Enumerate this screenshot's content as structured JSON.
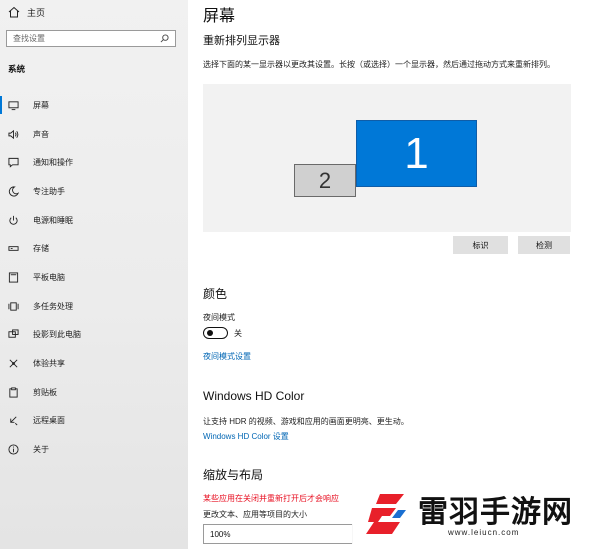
{
  "sidebar": {
    "home_label": "主页",
    "search_placeholder": "查找设置",
    "section_label": "系统",
    "items": [
      {
        "label": "屏幕",
        "icon": "monitor-icon",
        "active": true
      },
      {
        "label": "声音",
        "icon": "speaker-icon"
      },
      {
        "label": "通知和操作",
        "icon": "notification-icon"
      },
      {
        "label": "专注助手",
        "icon": "moon-icon"
      },
      {
        "label": "电源和睡眠",
        "icon": "power-icon"
      },
      {
        "label": "存储",
        "icon": "storage-icon"
      },
      {
        "label": "平板电脑",
        "icon": "tablet-icon"
      },
      {
        "label": "多任务处理",
        "icon": "multitask-icon"
      },
      {
        "label": "投影到此电脑",
        "icon": "project-icon"
      },
      {
        "label": "体验共享",
        "icon": "share-icon"
      },
      {
        "label": "剪贴板",
        "icon": "clipboard-icon"
      },
      {
        "label": "远程桌面",
        "icon": "remote-desktop-icon"
      },
      {
        "label": "关于",
        "icon": "info-icon"
      }
    ]
  },
  "main": {
    "title": "屏幕",
    "rearrange_heading": "重新排列显示器",
    "rearrange_desc": "选择下面的某一显示器以更改其设置。长按（或选择）一个显示器，然后通过拖动方式来重新排列。",
    "monitors": [
      "1",
      "2"
    ],
    "identify_label": "标识",
    "detect_label": "检测",
    "color_heading": "颜色",
    "night_mode_label": "夜间模式",
    "night_mode_state": "关",
    "night_mode_settings_link": "夜间模式设置",
    "hd_color_heading": "Windows HD Color",
    "hd_color_desc": "让支持 HDR 的视频、游戏和应用的画面更明亮、更生动。",
    "hd_color_link": "Windows HD Color 设置",
    "scale_heading": "缩放与布局",
    "scale_warning": "某些应用在关闭并重新打开后才会响应",
    "scale_label": "更改文本、应用等项目的大小",
    "scale_value": "100%"
  },
  "watermark": {
    "text": "雷羽手游网",
    "url": "www.leiucn.com",
    "accent_color": "#e8202a"
  }
}
